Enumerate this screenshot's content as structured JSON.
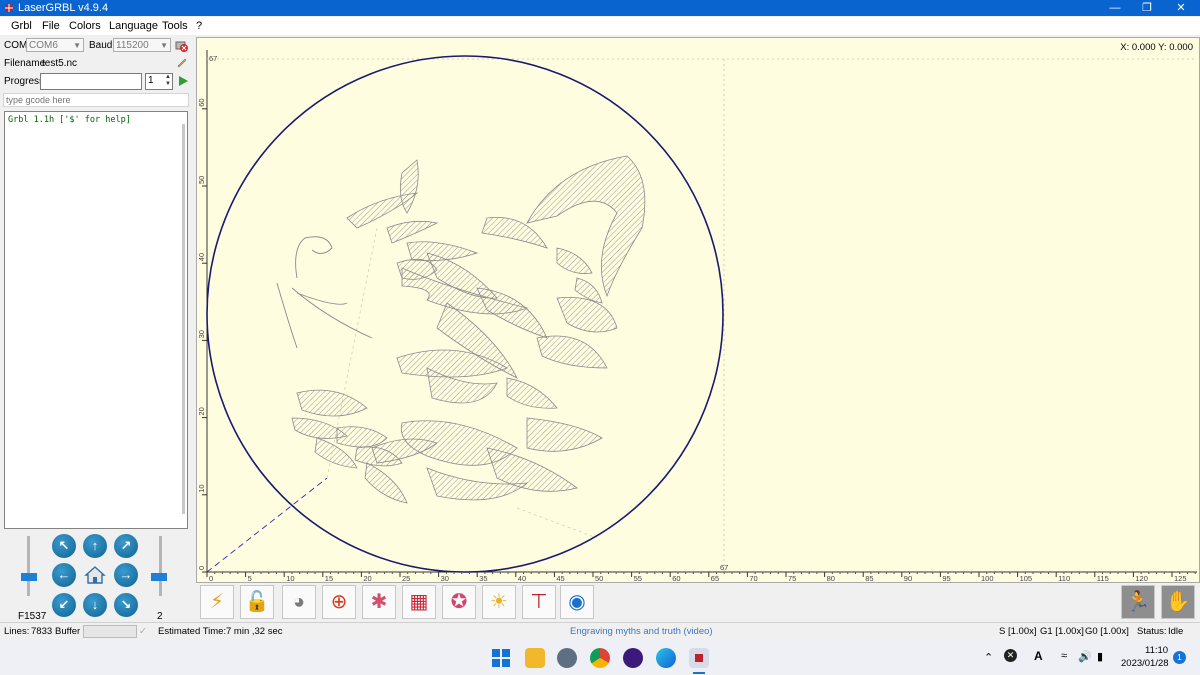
{
  "window": {
    "title": "LaserGRBL v4.9.4"
  },
  "menu": [
    "Grbl",
    "File",
    "Colors",
    "Language",
    "Tools",
    "?"
  ],
  "connection": {
    "com_label": "COM",
    "com_value": "COM6",
    "baud_label": "Baud",
    "baud_value": "115200"
  },
  "file": {
    "filename_label": "Filename",
    "filename_value": "test5.nc",
    "progress_label": "Progress",
    "copies": "1"
  },
  "gcode_input": {
    "placeholder": "type gcode here"
  },
  "console": {
    "line": "Grbl 1.1h ['$' for help]"
  },
  "jog": {
    "speed_label": "F1537",
    "step_label": "2",
    "speed_level": 0.5,
    "step_level": 0.5
  },
  "canvas": {
    "coords": "X: 0.000 Y: 0.000",
    "y_max_label": "67",
    "x_mark_label": "67",
    "y_ticks": [
      "60",
      "50",
      "40",
      "30",
      "20",
      "10",
      "0"
    ],
    "x_ticks": [
      "0",
      "5",
      "10",
      "15",
      "20",
      "25",
      "30",
      "35",
      "40",
      "45",
      "50",
      "55",
      "60",
      "65",
      "70",
      "75",
      "80",
      "85",
      "90",
      "95",
      "100",
      "105",
      "110",
      "115",
      "120",
      "125"
    ]
  },
  "toolbar": {
    "buttons": [
      "connect-icon",
      "unlock-icon",
      "globe-icon",
      "crosshair-icon",
      "star-icon",
      "frame-icon",
      "pattern-icon",
      "light-icon",
      "focus-icon",
      "colors-icon"
    ],
    "right_buttons": [
      "walk-icon",
      "hand-icon"
    ]
  },
  "status": {
    "lines_label": "Lines:",
    "lines_value": "7833",
    "buffer_label": "Buffer",
    "estimated_label": "Estimated Time:",
    "estimated_value": "7 min ,32 sec",
    "center_text": "Engraving myths and truth (video)",
    "s_override": "S [1.00x]",
    "g1_override": "G1 [1.00x]",
    "g0_override": "G0 [1.00x]",
    "status_label": "Status:",
    "status_value": "Idle",
    "link_color": "#3b78c0"
  },
  "taskbar": {
    "time": "11:10",
    "date": "2023/01/28",
    "notification_count": "1"
  }
}
